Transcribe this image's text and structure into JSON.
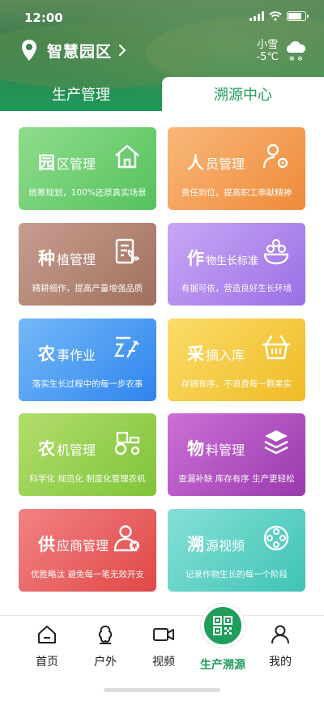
{
  "status": {
    "time": "12:00"
  },
  "header": {
    "location": "智慧园区",
    "weather_desc": "小雪",
    "weather_temp": "-5℃"
  },
  "tabs": [
    {
      "label": "生产管理",
      "active": false
    },
    {
      "label": "溯源中心",
      "active": true
    }
  ],
  "cards": [
    {
      "big": "园",
      "rest": "区管理",
      "desc": "统筹规划，100%还原真实场景",
      "icon": "house-icon",
      "colors": [
        "#8fdc8d",
        "#55c25c"
      ]
    },
    {
      "big": "人",
      "rest": "员管理",
      "desc": "责任到位，提高职工奉献精神",
      "icon": "user-gear-icon",
      "colors": [
        "#f8b87a",
        "#ef8a3a"
      ]
    },
    {
      "big": "种",
      "rest": "植管理",
      "desc": "精耕细作，提高产量增强品质",
      "icon": "planting-doc-icon",
      "colors": [
        "#c89d8e",
        "#a0705e"
      ]
    },
    {
      "big": "作",
      "rest": "物生长标准",
      "desc": "有据可依，营造良好生长环境",
      "icon": "crop-bowl-icon",
      "colors": [
        "#c8a8f5",
        "#9a6fe6"
      ]
    },
    {
      "big": "农",
      "rest": "事作业",
      "desc": "落实生长过程中的每一步农事",
      "icon": "farm-task-icon",
      "colors": [
        "#74b8f8",
        "#2f85ee"
      ]
    },
    {
      "big": "采",
      "rest": "摘入库",
      "desc": "存销有序，不浪费每一颗果实",
      "icon": "basket-icon",
      "colors": [
        "#fbdc6a",
        "#efbb24"
      ]
    },
    {
      "big": "农",
      "rest": "机管理",
      "desc": "科学化 规范化 制度化管理农机",
      "icon": "tractor-icon",
      "colors": [
        "#b2dd6c",
        "#7fc43a"
      ]
    },
    {
      "big": "物",
      "rest": "料管理",
      "desc": "查漏补缺 库存有序 生产更轻松",
      "icon": "layers-icon",
      "colors": [
        "#cc70d6",
        "#9a3aad"
      ]
    },
    {
      "big": "供",
      "rest": "应商管理",
      "desc": "优胜略汰 避免每一笔无效开支",
      "icon": "supplier-icon",
      "colors": [
        "#f28282",
        "#e04848"
      ]
    },
    {
      "big": "溯",
      "rest": "源视频",
      "desc": "记录作物生长的每一个阶段",
      "icon": "video-reel-icon",
      "colors": [
        "#86e0d6",
        "#3fc3b6"
      ]
    }
  ],
  "nav": [
    {
      "label": "首页",
      "icon": "home-icon",
      "active": false
    },
    {
      "label": "户外",
      "icon": "outdoor-icon",
      "active": false
    },
    {
      "label": "视频",
      "icon": "video-camera-icon",
      "active": false
    },
    {
      "label": "生产溯源",
      "icon": "qr-code-icon",
      "active": true
    },
    {
      "label": "我的",
      "icon": "person-icon",
      "active": false
    }
  ]
}
